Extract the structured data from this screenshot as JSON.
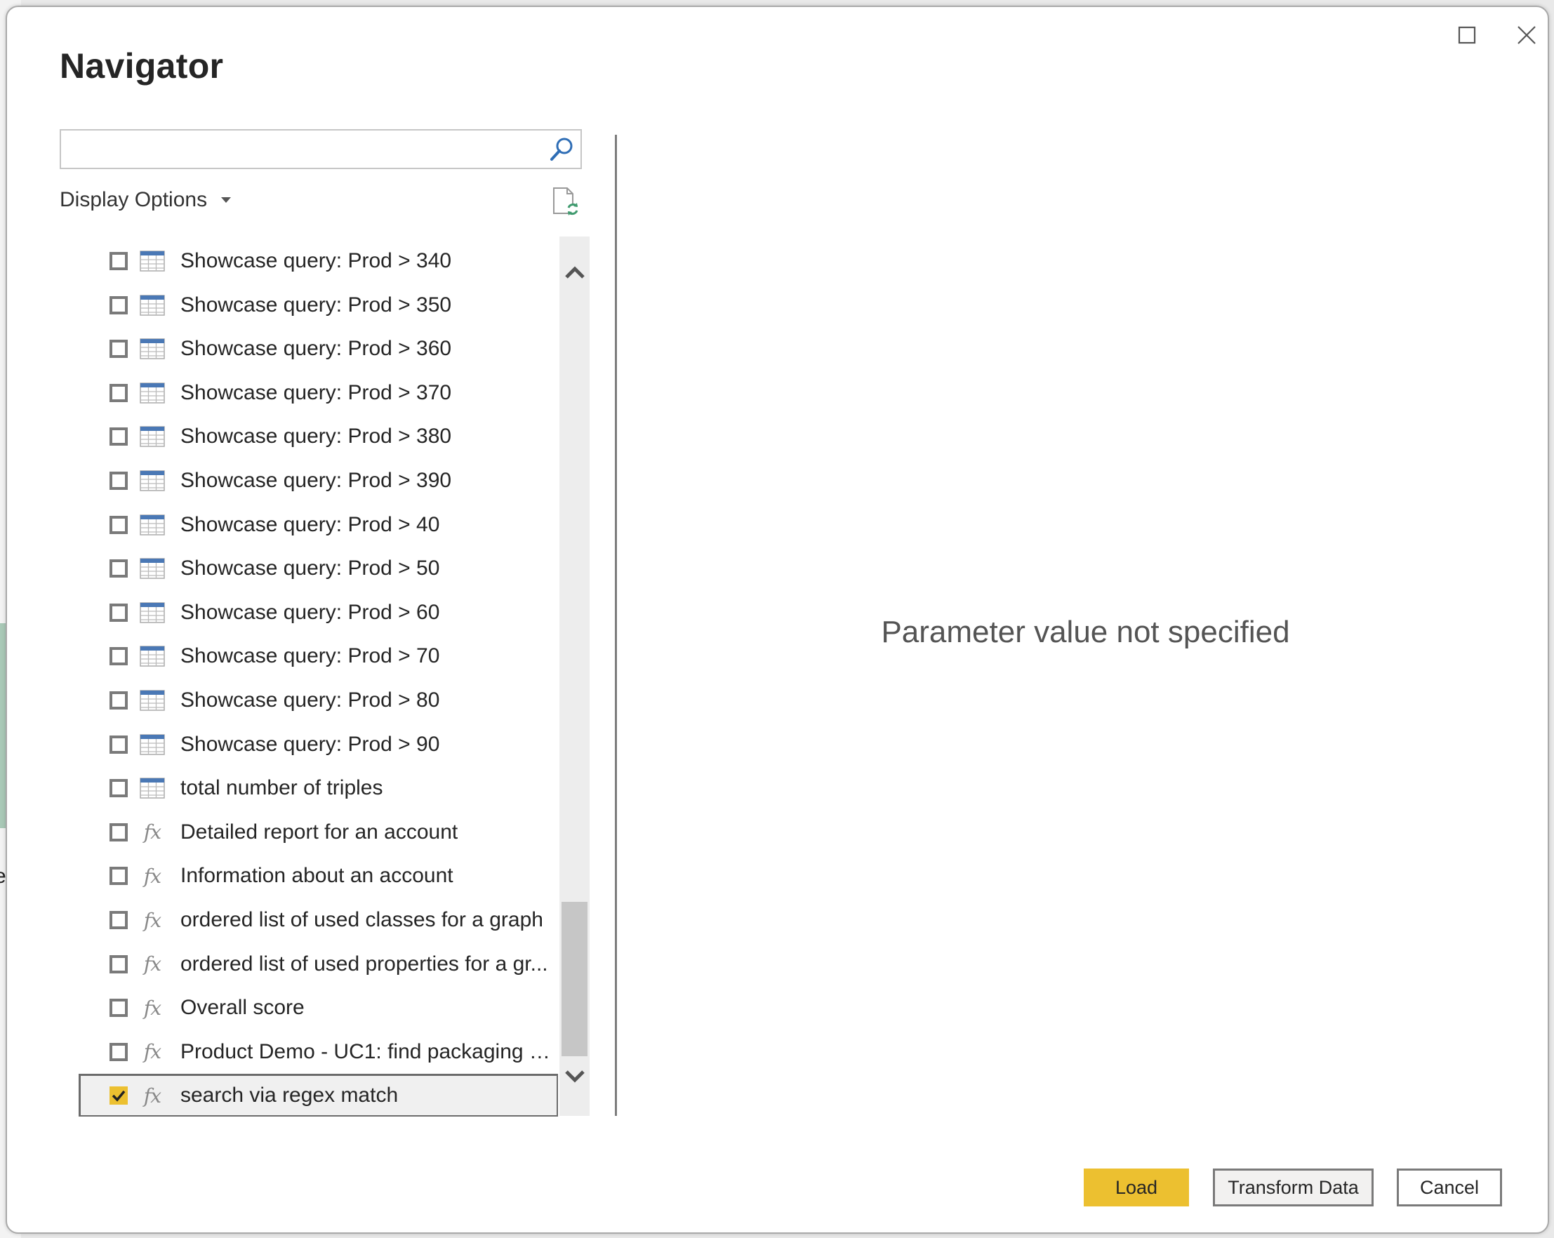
{
  "background": {
    "partial_letter": "e"
  },
  "window": {
    "title": "Navigator",
    "controls": {
      "maximize": "maximize-icon",
      "close": "close-icon"
    }
  },
  "search": {
    "value": "",
    "placeholder": "",
    "icon": "search-icon"
  },
  "display_options": {
    "label": "Display Options",
    "icon": "caret-down-icon"
  },
  "refresh": {
    "icon": "refresh-document-icon"
  },
  "list": {
    "items": [
      {
        "label": "Showcase query: Prod > 340",
        "type": "table",
        "checked": false
      },
      {
        "label": "Showcase query: Prod > 350",
        "type": "table",
        "checked": false
      },
      {
        "label": "Showcase query: Prod > 360",
        "type": "table",
        "checked": false
      },
      {
        "label": "Showcase query: Prod > 370",
        "type": "table",
        "checked": false
      },
      {
        "label": "Showcase query: Prod > 380",
        "type": "table",
        "checked": false
      },
      {
        "label": "Showcase query: Prod > 390",
        "type": "table",
        "checked": false
      },
      {
        "label": "Showcase query: Prod > 40",
        "type": "table",
        "checked": false
      },
      {
        "label": "Showcase query: Prod > 50",
        "type": "table",
        "checked": false
      },
      {
        "label": "Showcase query: Prod > 60",
        "type": "table",
        "checked": false
      },
      {
        "label": "Showcase query: Prod > 70",
        "type": "table",
        "checked": false
      },
      {
        "label": "Showcase query: Prod > 80",
        "type": "table",
        "checked": false
      },
      {
        "label": "Showcase query: Prod > 90",
        "type": "table",
        "checked": false
      },
      {
        "label": "total number of triples",
        "type": "table",
        "checked": false
      },
      {
        "label": "Detailed report for an account",
        "type": "function",
        "checked": false
      },
      {
        "label": "Information about an account",
        "type": "function",
        "checked": false
      },
      {
        "label": "ordered list of used classes for a graph",
        "type": "function",
        "checked": false
      },
      {
        "label": "ordered list of used properties for a gr...",
        "type": "function",
        "checked": false
      },
      {
        "label": "Overall score",
        "type": "function",
        "checked": false
      },
      {
        "label": "Product Demo - UC1: find packaging g...",
        "type": "function",
        "checked": false
      },
      {
        "label": "search via regex match",
        "type": "function",
        "checked": true,
        "selected": true
      }
    ],
    "function_icon_text": "fx"
  },
  "preview": {
    "message": "Parameter value not specified"
  },
  "buttons": {
    "load": "Load",
    "transform": "Transform Data",
    "cancel": "Cancel"
  },
  "colors": {
    "accent": "#ecc030",
    "table_icon_header": "#4a78b5",
    "refresh_icon": "#3f9a6e",
    "search_icon": "#2e6db5"
  }
}
